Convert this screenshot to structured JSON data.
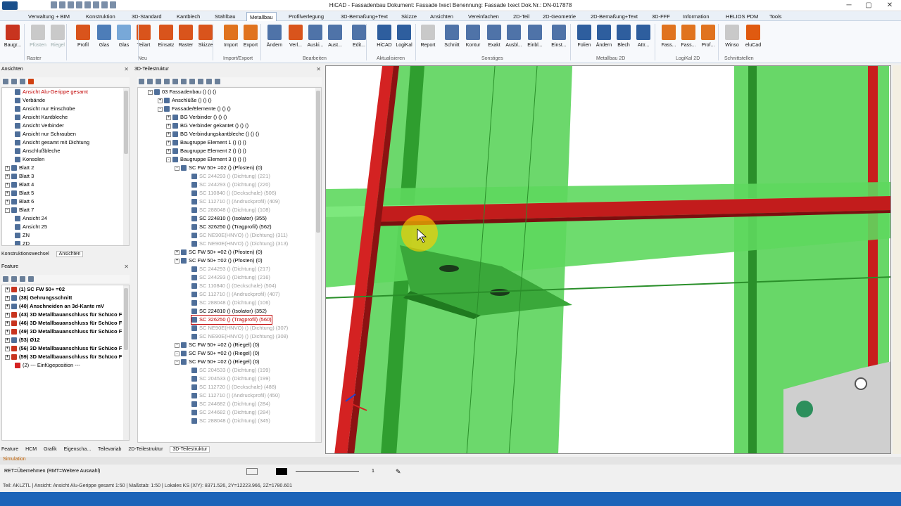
{
  "window": {
    "title": "HiCAD - Fassadenbau  Dokument: Fassade Ixect  Benennung: Fassade Ixect  Dok.Nr.: DN-017878",
    "minimize": "─",
    "maximize": "▢",
    "close": "✕"
  },
  "menu": {
    "tabs": [
      {
        "label": "Verwaltung + BIM"
      },
      {
        "label": "Konstruktion"
      },
      {
        "label": "3D-Standard"
      },
      {
        "label": "Kantblech"
      },
      {
        "label": "Stahlbau"
      },
      {
        "label": "Metallbau"
      },
      {
        "label": "Profilverlegung"
      },
      {
        "label": "3D-Bemaßung+Text"
      },
      {
        "label": "Skizze"
      },
      {
        "label": "Ansichten"
      },
      {
        "label": "Vereinfachen"
      },
      {
        "label": "2D-Teil"
      },
      {
        "label": "2D-Geometrie"
      },
      {
        "label": "2D-Bemaßung+Text"
      },
      {
        "label": "3D-FFF"
      },
      {
        "label": "Information"
      },
      {
        "label": "HELIOS PDM"
      },
      {
        "label": "Tools"
      }
    ],
    "active": "Metallbau"
  },
  "ribbon": {
    "buttons": [
      {
        "label": "Baugr...",
        "color": "#c8341f"
      },
      {
        "label": "Pfosten",
        "color": "#c9c9c9",
        "disabled": true
      },
      {
        "label": "Riegel",
        "color": "#c9c9c9",
        "disabled": true
      },
      {
        "label": "Profil",
        "color": "#d9541c"
      },
      {
        "label": "Glas",
        "color": "#4d7db8"
      },
      {
        "label": "Glas",
        "color": "#78a8d8"
      },
      {
        "label": "Teilart",
        "color": "#d9541c"
      },
      {
        "label": "Einsatz",
        "color": "#d9541c"
      },
      {
        "label": "Raster",
        "color": "#d9541c"
      },
      {
        "label": "Skizze",
        "color": "#d9541c"
      },
      {
        "label": "Import",
        "color": "#e0731f"
      },
      {
        "label": "Export",
        "color": "#e0731f"
      },
      {
        "label": "Ändern",
        "color": "#4f73a8"
      },
      {
        "label": "Verl...",
        "color": "#d9541c"
      },
      {
        "label": "Auski...",
        "color": "#4f73a8"
      },
      {
        "label": "Aust...",
        "color": "#4f73a8"
      },
      {
        "label": "Edit...",
        "color": "#4f73a8"
      },
      {
        "label": "HiCAD",
        "color": "#2e5e9e"
      },
      {
        "label": "LogiKal",
        "color": "#2e5e9e"
      },
      {
        "label": "Report",
        "color": "#c9c9c9"
      },
      {
        "label": "Schnitt",
        "color": "#4f73a8"
      },
      {
        "label": "Kontur",
        "color": "#4f73a8"
      },
      {
        "label": "Exakt",
        "color": "#4f73a8"
      },
      {
        "label": "Ausbl...",
        "color": "#4f73a8"
      },
      {
        "label": "Einbl...",
        "color": "#4f73a8"
      },
      {
        "label": "Einst...",
        "color": "#4f73a8"
      },
      {
        "label": "Folien",
        "color": "#2e5e9e"
      },
      {
        "label": "Ändern",
        "color": "#2e5e9e"
      },
      {
        "label": "Blech",
        "color": "#2e5e9e"
      },
      {
        "label": "Attr...",
        "color": "#2e5e9e"
      },
      {
        "label": "Fass...",
        "color": "#e0731f"
      },
      {
        "label": "Fass...",
        "color": "#e0731f"
      },
      {
        "label": "Prof...",
        "color": "#e0731f"
      },
      {
        "label": "Winso",
        "color": "#c9c9c9"
      },
      {
        "label": "eluCad",
        "color": "#e05a10"
      }
    ],
    "groups": [
      {
        "label": "Raster"
      },
      {
        "label": "Neu"
      },
      {
        "label": "Import/Export"
      },
      {
        "label": "Bearbeiten"
      },
      {
        "label": "Aktualisieren"
      },
      {
        "label": "Sonstiges"
      },
      {
        "label": "Metallbau 2D"
      },
      {
        "label": "LogiKal 2D"
      },
      {
        "label": "Schnittstellen"
      }
    ]
  },
  "ansichten": {
    "header": "Ansichten",
    "items": [
      {
        "label": "Ansicht Alu-Gerippe gesamt"
      },
      {
        "label": "Verbände"
      },
      {
        "label": "Ansicht nur Einschübe"
      },
      {
        "label": "Ansicht Kantbleche"
      },
      {
        "label": "Ansicht Verbinder"
      },
      {
        "label": "Ansicht nur Schrauben"
      },
      {
        "label": "Ansicht gesamt mit Dichtung"
      },
      {
        "label": "Anschlußbleche"
      },
      {
        "label": "Konsolen"
      },
      {
        "label": "Blatt 2"
      },
      {
        "label": "Blatt 3"
      },
      {
        "label": "Blatt 4"
      },
      {
        "label": "Blatt 5"
      },
      {
        "label": "Blatt 6"
      },
      {
        "label": "Blatt 7"
      },
      {
        "label": "Ansicht 24"
      },
      {
        "label": "Ansicht 25"
      },
      {
        "label": "ZN"
      },
      {
        "label": "ZD"
      }
    ],
    "tabs": [
      {
        "label": "Konstruktionswechsel"
      },
      {
        "label": "Ansichten"
      }
    ]
  },
  "feature": {
    "header": "Feature",
    "items": [
      {
        "label": "(1) SC FW 50+ =02"
      },
      {
        "label": "(38) Gehrungsschnitt"
      },
      {
        "label": "(40) Anschneiden an 3d-Kante mV"
      },
      {
        "label": "(43) 3D Metallbauanschluss für Schüco F"
      },
      {
        "label": "(46) 3D Metallbauanschluss für Schüco F"
      },
      {
        "label": "(49) 3D Metallbauanschluss für Schüco F"
      },
      {
        "label": "(53) Ø12"
      },
      {
        "label": "(56) 3D Metallbauanschluss für Schüco F"
      },
      {
        "label": "(59) 3D Metallbauanschluss für Schüco F"
      },
      {
        "label": "(2) --- Einfügeposition ---"
      }
    ]
  },
  "teilestruktur": {
    "header": "3D-Teilestruktur",
    "items": [
      {
        "label": "03 Fassadenbau () () ()"
      },
      {
        "label": "Anschlüße () () ()"
      },
      {
        "label": "Fassade/Elemente () () ()"
      },
      {
        "label": "BG Verbinder () () ()"
      },
      {
        "label": "BG Verbinder gekantet () () ()"
      },
      {
        "label": "BG Verbindungskantbleche () () ()"
      },
      {
        "label": "Baugruppe Element 1 () () ()"
      },
      {
        "label": "Baugruppe Element 2 () () ()"
      },
      {
        "label": "Baugruppe Element 3 () () ()"
      },
      {
        "label": "SC FW 50+ =02 () (Pfosten) (0)"
      },
      {
        "label": "SC 244293 () (Dichtung) (221)"
      },
      {
        "label": "SC 244293 () (Dichtung) (220)"
      },
      {
        "label": "SC 110840 () (Deckschale) (506)"
      },
      {
        "label": "SC 112710 () (Andruckprofil) (409)"
      },
      {
        "label": "SC 288048 () (Dichtung) (108)"
      },
      {
        "label": "SC 224810 () (Isolator) (355)"
      },
      {
        "label": "SC 326250 () (Tragprofil) (562)"
      },
      {
        "label": "SC NE90E(HNVO) () (Dichtung) (311)"
      },
      {
        "label": "SC NE90E(HNVO) () (Dichtung) (313)"
      },
      {
        "label": "SC FW 50+ =02 () (Pfosten) (0)"
      },
      {
        "label": "SC FW 50+ =02 () (Pfosten) (0)"
      },
      {
        "label": "SC 244293 () (Dichtung) (217)"
      },
      {
        "label": "SC 244293 () (Dichtung) (216)"
      },
      {
        "label": "SC 110840 () (Deckschale) (504)"
      },
      {
        "label": "SC 112710 () (Andruckprofil) (407)"
      },
      {
        "label": "SC 288048 () (Dichtung) (106)"
      },
      {
        "label": "SC 224810 () (Isolator) (352)"
      },
      {
        "label": "SC 326250 () (Tragprofil) (560)"
      },
      {
        "label": "SC NE90E(HNVO) () (Dichtung) (307)"
      },
      {
        "label": "SC NE90E(HNVO) () (Dichtung) (308)"
      },
      {
        "label": "SC FW 50+ =02 () (Riegel) (0)"
      },
      {
        "label": "SC FW 50+ =02 () (Riegel) (0)"
      },
      {
        "label": "SC FW 50+ =02 () (Riegel) (0)"
      },
      {
        "label": "SC 204533 () (Dichtung) (199)"
      },
      {
        "label": "SC 204533 () (Dichtung) (199)"
      },
      {
        "label": "SC 112720 () (Deckschale) (488)"
      },
      {
        "label": "SC 112710 () (Andruckprofil) (450)"
      },
      {
        "label": "SC 244682 () (Dichtung) (284)"
      },
      {
        "label": "SC 244682 () (Dichtung) (284)"
      },
      {
        "label": "SC 288048 () (Dichtung) (345)"
      }
    ]
  },
  "bottom_tabs": [
    {
      "label": "Feature"
    },
    {
      "label": "HCM"
    },
    {
      "label": "Grafik"
    },
    {
      "label": "Eigenscha..."
    },
    {
      "label": "Teilevariab"
    },
    {
      "label": "2D-Teilestruktur"
    },
    {
      "label": "3D-Teilestruktur"
    }
  ],
  "status": {
    "simulation": "Simulation",
    "prompt": "RET=Übernehmen (RMT=Weitere Auswahl)",
    "layer_value": "1",
    "info_line": "Teil: AKLZTL | Ansicht: Ansicht Alu-Gerippe gesamt 1:50 | Maßstab: 1:50 | Lokales KS (X/Y): 8371.526, 2Y=12223.966, 2Z=1780.601"
  }
}
